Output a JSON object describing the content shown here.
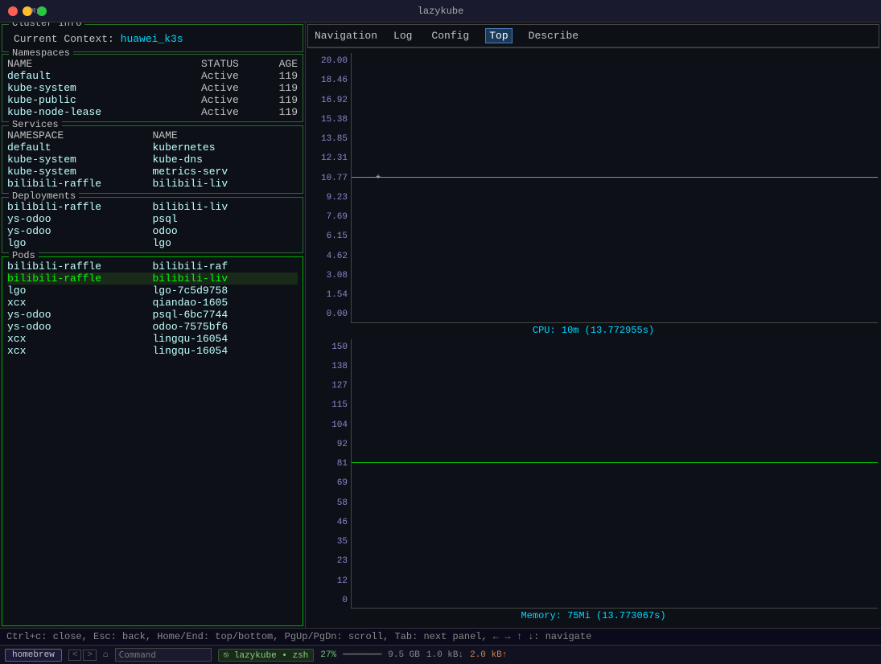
{
  "titleBar": {
    "title": "lazykube",
    "cmd": "⌘1"
  },
  "clusterInfo": {
    "sectionTitle": "Cluster Info",
    "contextLabel": "Current Context:",
    "contextValue": "huawei_k3s"
  },
  "namespaces": {
    "sectionTitle": "Namespaces",
    "columns": [
      "NAME",
      "STATUS",
      "AGE"
    ],
    "rows": [
      {
        "name": "default",
        "status": "Active",
        "age": "119"
      },
      {
        "name": "kube-system",
        "status": "Active",
        "age": "119"
      },
      {
        "name": "kube-public",
        "status": "Active",
        "age": "119"
      },
      {
        "name": "kube-node-lease",
        "status": "Active",
        "age": "119"
      }
    ]
  },
  "services": {
    "sectionTitle": "Services",
    "columns": [
      "NAMESPACE",
      "NAME"
    ],
    "rows": [
      {
        "namespace": "default",
        "name": "kubernetes"
      },
      {
        "namespace": "kube-system",
        "name": "kube-dns"
      },
      {
        "namespace": "kube-system",
        "name": "metrics-serv"
      },
      {
        "namespace": "bilibili-raffle",
        "name": "bilibili-liv"
      }
    ]
  },
  "deployments": {
    "sectionTitle": "Deployments",
    "columns": [
      "",
      ""
    ],
    "rows": [
      {
        "namespace": "bilibili-raffle",
        "name": "bilibili-liv"
      },
      {
        "namespace": "ys-odoo",
        "name": "psql"
      },
      {
        "namespace": "ys-odoo",
        "name": "odoo"
      },
      {
        "namespace": "lgo",
        "name": "lgo"
      }
    ]
  },
  "pods": {
    "sectionTitle": "Pods",
    "rows": [
      {
        "namespace": "bilibili-raffle",
        "name": "bilibili-raf",
        "highlight": false
      },
      {
        "namespace": "bilibili-raffle",
        "name": "bilibili-liv",
        "highlight": true
      },
      {
        "namespace": "lgo",
        "name": "lgo-7c5d9758",
        "highlight": false
      },
      {
        "namespace": "xcx",
        "name": "qiandao-1605",
        "highlight": false
      },
      {
        "namespace": "ys-odoo",
        "name": "psql-6bc7744",
        "highlight": false
      },
      {
        "namespace": "ys-odoo",
        "name": "odoo-7575bf6",
        "highlight": false
      },
      {
        "namespace": "xcx",
        "name": "lingqu-16054",
        "highlight": false
      },
      {
        "namespace": "xcx",
        "name": "lingqu-16054",
        "highlight": false
      }
    ]
  },
  "navigation": {
    "sectionTitle": "Navigation",
    "tabs": [
      "Log",
      "Config",
      "Top",
      "Describe"
    ],
    "activeTab": "Top"
  },
  "cpuChart": {
    "label": "CPU: 10m (13.772955s)",
    "yAxis": [
      "20.00",
      "18.46",
      "16.92",
      "15.38",
      "13.85",
      "12.31",
      "10.77",
      "9.23",
      "7.69",
      "6.15",
      "4.62",
      "3.08",
      "1.54",
      "0.00"
    ],
    "lineY": "10.77"
  },
  "memChart": {
    "label": "Memory: 75Mi (13.773067s)",
    "yAxis": [
      "150",
      "138",
      "127",
      "115",
      "104",
      "92",
      "81",
      "69",
      "58",
      "46",
      "35",
      "23",
      "12",
      "0"
    ],
    "lineY": "81"
  },
  "statusBar": {
    "text": "Ctrl+c: close, Esc: back, Home/End: top/bottom, PgUp/PgDn: scroll, Tab: next panel, ← → ↑ ↓: navigate"
  },
  "terminalBar": {
    "tabs": [
      {
        "label": "homebrew",
        "active": true
      }
    ],
    "navButtons": [
      "<",
      ">"
    ],
    "prompt": "⌂",
    "inputPlaceholder": "Command",
    "badge": "⎋ lazykube • zsh",
    "percent": "27%",
    "disk": "9.5 GB",
    "download": "1.0 kB↓",
    "upload": "2.0 kB↑"
  }
}
